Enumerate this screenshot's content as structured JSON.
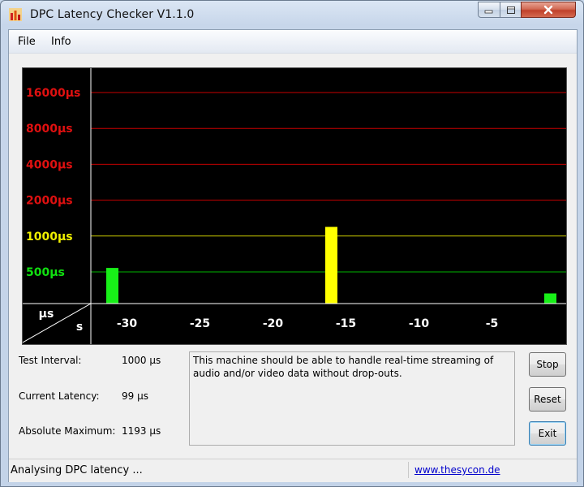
{
  "window": {
    "title": "DPC Latency Checker V1.1.0"
  },
  "menu": {
    "items": [
      "File",
      "Info"
    ]
  },
  "graph": {
    "y_labels": [
      {
        "text": "16000µs",
        "value_us": 16000,
        "color": "#e01010"
      },
      {
        "text": "8000µs",
        "value_us": 8000,
        "color": "#e01010"
      },
      {
        "text": "4000µs",
        "value_us": 4000,
        "color": "#e01010"
      },
      {
        "text": "2000µs",
        "value_us": 2000,
        "color": "#e01010"
      },
      {
        "text": "1000µs",
        "value_us": 1000,
        "color": "#f0f000"
      },
      {
        "text": "500µs",
        "value_us": 500,
        "color": "#10e010"
      }
    ],
    "x_ticks": [
      "-30",
      "-25",
      "-20",
      "-15",
      "-10",
      "-5"
    ],
    "x_tick_values": [
      -30,
      -25,
      -20,
      -15,
      -10,
      -5
    ],
    "corner": {
      "y_unit": "µs",
      "x_unit": "s"
    },
    "colors": {
      "green": "#18f018",
      "yellow": "#ffff00",
      "red_line": "#c80000",
      "yellow_line": "#c8c800",
      "green_line": "#00b400"
    }
  },
  "chart_data": {
    "type": "bar",
    "x_label": "s",
    "y_label": "µs",
    "x": [
      -32,
      -31,
      -30,
      -29,
      -28,
      -27,
      -26,
      -25,
      -24,
      -23,
      -22,
      -21,
      -20,
      -19,
      -18,
      -17,
      -16,
      -15,
      -14,
      -13,
      -12,
      -11,
      -10,
      -9,
      -8,
      -7,
      -6,
      -5,
      -4,
      -3,
      -2,
      -1,
      0
    ],
    "values": [
      140,
      540,
      170,
      160,
      150,
      130,
      140,
      140,
      170,
      160,
      130,
      130,
      130,
      140,
      180,
      150,
      1193,
      170,
      180,
      140,
      140,
      140,
      150,
      140,
      170,
      170,
      140,
      140,
      170,
      150,
      180,
      330,
      150
    ],
    "highlight_index": 16,
    "yscale": "log2",
    "y_ticks": [
      500,
      1000,
      2000,
      4000,
      8000,
      16000
    ]
  },
  "info": {
    "test_interval_label": "Test Interval:",
    "test_interval_value": "1000 µs",
    "current_latency_label": "Current Latency:",
    "current_latency_value": "99 µs",
    "absolute_maximum_label": "Absolute Maximum:",
    "absolute_maximum_value": "1193 µs"
  },
  "message": "This machine should be able to handle real-time streaming of audio and/or video data without drop-outs.",
  "buttons": {
    "stop": "Stop",
    "reset": "Reset",
    "exit": "Exit"
  },
  "status": {
    "text": "Analysing DPC latency ...",
    "link": "www.thesycon.de"
  }
}
